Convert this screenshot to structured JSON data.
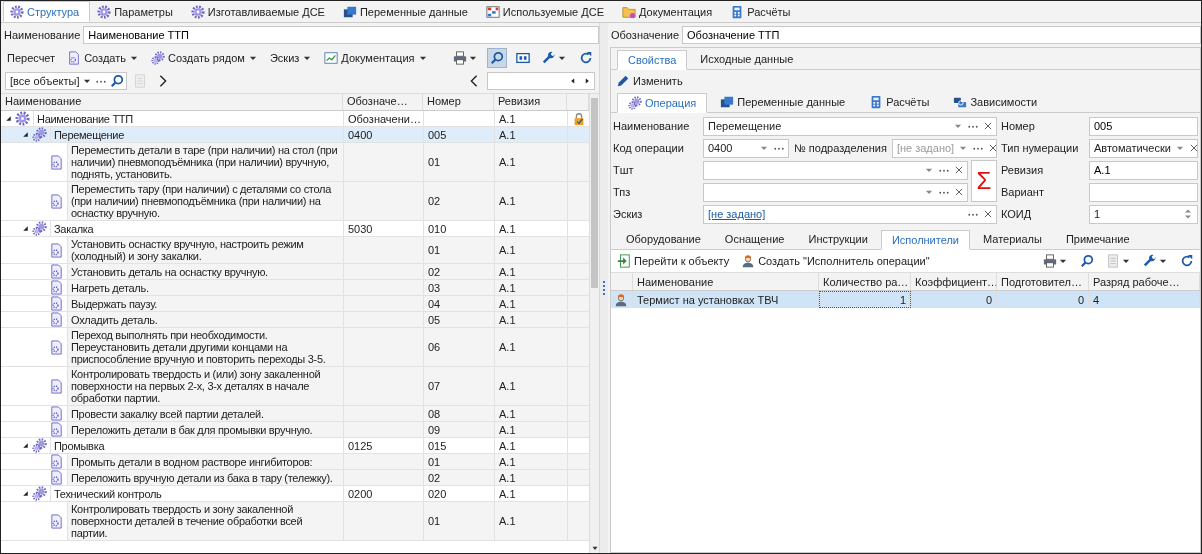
{
  "top_tabs": [
    {
      "label": "Структура",
      "selected": true
    },
    {
      "label": "Параметры",
      "selected": false
    },
    {
      "label": "Изготавливаемые ДСЕ",
      "selected": false
    },
    {
      "label": "Переменные данные",
      "selected": false
    },
    {
      "label": "Используемые ДСЕ",
      "selected": false
    },
    {
      "label": "Документация",
      "selected": false
    },
    {
      "label": "Расчёты",
      "selected": false
    }
  ],
  "left": {
    "name_field": {
      "label": "Наименование",
      "value": "Наименование ТТП"
    },
    "toolbar": [
      {
        "label": "Пересчет",
        "kind": "plain"
      },
      {
        "label": "Создать",
        "kind": "menu"
      },
      {
        "label": "Создать рядом",
        "kind": "menu"
      },
      {
        "label": "Эскиз",
        "kind": "menu"
      },
      {
        "label": "Документация",
        "kind": "menu"
      }
    ],
    "search_toggle": {
      "on": true
    },
    "filter": {
      "value": "[все объекты]"
    },
    "tree": {
      "columns": [
        "Наименование",
        "Обозначе…",
        "Номер",
        "Ревизия"
      ],
      "root": {
        "kind": "root",
        "name": "Наименование ТТП",
        "designation": "Обозначени…",
        "revision": "А.1",
        "expanded": true,
        "children": [
          {
            "kind": "operation",
            "name": "Перемещение",
            "designation": "0400",
            "number": "005",
            "revision": "А.1",
            "expanded": true,
            "selected": true,
            "children": [
              {
                "kind": "step",
                "name": "Переместить детали в таре (при наличии) на стол (при наличии) пневмоподъёмника (при наличии) вручную, поднять, установить.",
                "number": "01",
                "revision": "А.1"
              },
              {
                "kind": "step",
                "name": "Переместить тару (при наличии) с деталями со стола (при наличии) пневмоподъёмника (при наличии) на оснастку вручную.",
                "number": "02",
                "revision": "А.1"
              }
            ]
          },
          {
            "kind": "operation",
            "name": "Закалка",
            "designation": "5030",
            "number": "010",
            "revision": "А.1",
            "expanded": true,
            "selected": false,
            "children": [
              {
                "kind": "step",
                "name": "Установить оснастку вручную, настроить режим (холодный) и зону закалки.",
                "number": "01",
                "revision": "А.1"
              },
              {
                "kind": "step",
                "name": "Установить деталь на оснастку вручную.",
                "number": "02",
                "revision": "А.1"
              },
              {
                "kind": "step",
                "name": "Нагреть деталь.",
                "number": "03",
                "revision": "А.1"
              },
              {
                "kind": "step",
                "name": "Выдержать паузу.",
                "number": "04",
                "revision": "А.1"
              },
              {
                "kind": "step",
                "name": "Охладить деталь.",
                "number": "05",
                "revision": "А.1"
              },
              {
                "kind": "step",
                "name": "Переход выполнять при необходимости. Переустановить детали другими концами на приспособление вручную и повторить переходы 3-5.",
                "number": "06",
                "revision": "А.1"
              },
              {
                "kind": "step",
                "name": "Контролировать твердость и (или) зону закаленной поверхности на первых 2-х, 3-х деталях в начале обработки партии.",
                "number": "07",
                "revision": "А.1"
              },
              {
                "kind": "step",
                "name": "Провести закалку всей партии деталей.",
                "number": "08",
                "revision": "А.1"
              },
              {
                "kind": "step",
                "name": "Переложить детали в бак для промывки вручную.",
                "number": "09",
                "revision": "А.1"
              }
            ]
          },
          {
            "kind": "operation",
            "name": "Промывка",
            "designation": "0125",
            "number": "015",
            "revision": "А.1",
            "expanded": true,
            "selected": false,
            "children": [
              {
                "kind": "step",
                "name": "Промыть детали в водном растворе ингибиторов:",
                "number": "01",
                "revision": "А.1"
              },
              {
                "kind": "step",
                "name": "Переложить вручную детали из бака в тару (тележку).",
                "number": "02",
                "revision": "А.1"
              }
            ]
          },
          {
            "kind": "operation",
            "name": "Технический контроль",
            "designation": "0200",
            "number": "020",
            "revision": "А.1",
            "expanded": true,
            "selected": false,
            "children": [
              {
                "kind": "step",
                "name": "Контролировать твердость и зону закаленной поверхности деталей в течение обработки всей партии.",
                "number": "01",
                "revision": "А.1"
              }
            ]
          }
        ]
      }
    }
  },
  "right": {
    "designation_field": {
      "label": "Обозначение",
      "value": "Обозначение ТТП"
    },
    "tabs": [
      {
        "label": "Свойства",
        "selected": true
      },
      {
        "label": "Исходные данные",
        "selected": false
      }
    ],
    "edit_button": "Изменить",
    "object_tabs": [
      {
        "label": "Операция",
        "selected": true
      },
      {
        "label": "Переменные данные",
        "selected": false
      },
      {
        "label": "Расчёты",
        "selected": false
      },
      {
        "label": "Зависимости",
        "selected": false
      }
    ],
    "form": {
      "left": [
        {
          "kind": "combo",
          "label": "Наименование",
          "value": "Перемещение"
        },
        {
          "kind": "code",
          "label": "Код операции",
          "value": "0400",
          "extra_label": "№ подразделения",
          "placeholder": "[не задано]"
        },
        {
          "kind": "group",
          "button": "Σ",
          "fields": [
            {
              "label": "Тшт"
            },
            {
              "label": "Тпз"
            }
          ]
        },
        {
          "kind": "link",
          "label": "Эскиз",
          "value": "[не задано]"
        }
      ],
      "right": [
        {
          "kind": "text",
          "label": "Номер",
          "value": "005"
        },
        {
          "kind": "combo",
          "label": "Тип нумерации",
          "value": "Автоматически"
        },
        {
          "kind": "text",
          "label": "Ревизия",
          "value": "А.1"
        },
        {
          "kind": "text",
          "label": "Вариант"
        },
        {
          "kind": "spin",
          "label": "КОИД",
          "value": "1"
        }
      ]
    },
    "detail_tabs": [
      {
        "label": "Оборудование",
        "selected": false
      },
      {
        "label": "Оснащение",
        "selected": false
      },
      {
        "label": "Инструкции",
        "selected": false
      },
      {
        "label": "Исполнители",
        "selected": true
      },
      {
        "label": "Материалы",
        "selected": false
      },
      {
        "label": "Примечание",
        "selected": false
      }
    ],
    "detail_toolbar": [
      "Перейти к объекту",
      "Создать \"Исполнитель операции\""
    ],
    "performers": {
      "columns": [
        "Наименование",
        "Количество ра…",
        "Коэффициент…",
        "Подготовител…",
        "Разряд рабоче…"
      ],
      "rows": [
        {
          "selected": true,
          "cells": [
            "Термист на установках ТВЧ",
            "1",
            "0",
            "0",
            "4"
          ]
        }
      ]
    }
  }
}
